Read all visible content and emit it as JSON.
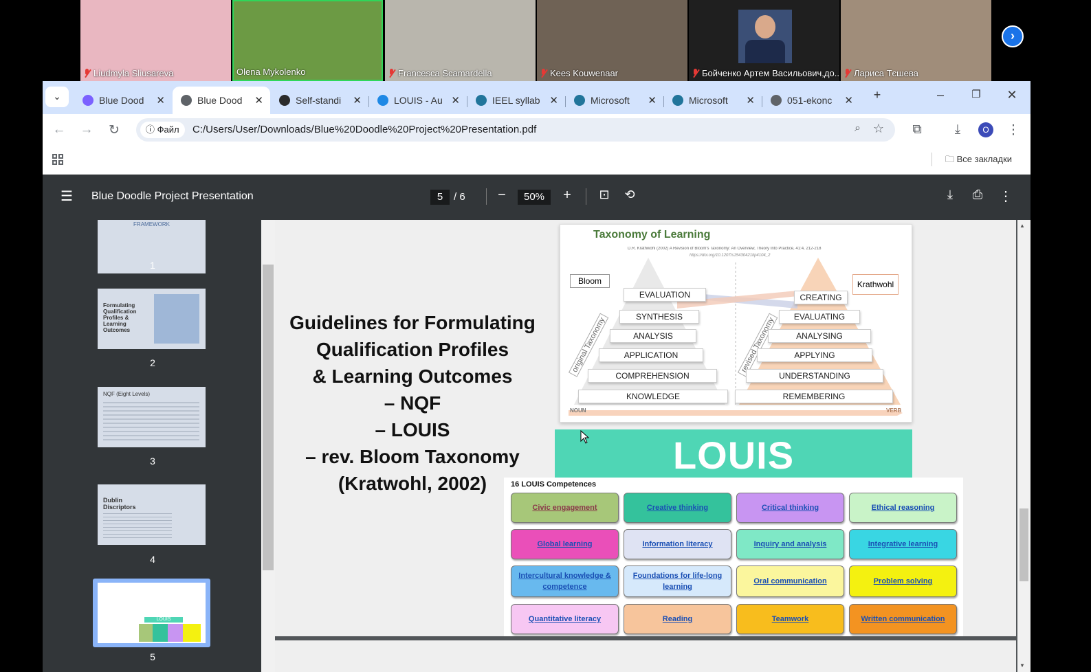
{
  "participants": [
    {
      "name": "Liudmyla Sliusareva",
      "muted": true,
      "bg": "#e9b7c1"
    },
    {
      "name": "Olena Mykolenko",
      "muted": false,
      "bg": "#6c9a44"
    },
    {
      "name": "Francesca Scamardella",
      "muted": true,
      "bg": "#b9b6ad"
    },
    {
      "name": "Kees Kouwenaar",
      "muted": true,
      "bg": "#6f6255"
    },
    {
      "name": "Бойченко Артем Васильович,до...",
      "muted": true,
      "bg": "#1f1f1f"
    },
    {
      "name": "Лариса Тєшева",
      "muted": true,
      "bg": "#a08d7a"
    }
  ],
  "browser": {
    "tabs": [
      {
        "title": "Blue Dood",
        "active": false,
        "color": "#7b61ff"
      },
      {
        "title": "Blue Dood",
        "active": true,
        "color": "#5f6368"
      },
      {
        "title": "Self-standi",
        "active": false,
        "color": "#2b2b2b"
      },
      {
        "title": "LOUIS - Au",
        "active": false,
        "color": "#1e88e5"
      },
      {
        "title": "IEEL syllab",
        "active": false,
        "color": "#21759b"
      },
      {
        "title": "Microsoft",
        "active": false,
        "color": "#21759b"
      },
      {
        "title": "Microsoft",
        "active": false,
        "color": "#21759b"
      },
      {
        "title": "051-ekonc",
        "active": false,
        "color": "#5f6368"
      }
    ],
    "file_chip": "Файл",
    "url": "C:/Users/User/Downloads/Blue%20Doodle%20Project%20Presentation.pdf",
    "profile_initial": "O",
    "bookmarks_label": "Все закладки"
  },
  "pdf": {
    "title": "Blue Doodle Project Presentation",
    "current_page": "5",
    "total_pages": "/ 6",
    "zoom": "50%",
    "thumbnails": [
      {
        "num": "1",
        "text": "FRAMEWORK"
      },
      {
        "num": "2",
        "text": "Formulating Qualification Profiles & Learning Outcomes"
      },
      {
        "num": "3",
        "text": "NQF (Eight Levels)"
      },
      {
        "num": "4",
        "text": "Dublin Discriptors"
      },
      {
        "num": "5",
        "text": "LOUIS"
      }
    ]
  },
  "slide": {
    "heading_lines": [
      "Guidelines for Formulating",
      "Qualification Profiles",
      "& Learning Outcomes",
      "– NQF",
      "– LOUIS",
      "– rev. Bloom Taxonomy",
      "(Kratwohl, 2002)"
    ],
    "taxonomy": {
      "title": "Taxonomy of Learning",
      "citation": "D.R. Krathwohl (2002) A Revision of Bloom's Taxonomy: An Overview, Theory Into Practice, 41:4, 212-218",
      "doi": "https://doi.org/10.1207/s15430421tip4104_2",
      "bloom_label": "Bloom",
      "krathwohl_label": "Krathwohl",
      "original_label": "original Taxonomy",
      "revised_label": "revised Taxonomy",
      "bloom_levels": [
        "EVALUATION",
        "SYNTHESIS",
        "ANALYSIS",
        "APPLICATION",
        "COMPREHENSION",
        "KNOWLEDGE"
      ],
      "revised_levels": [
        "CREATING",
        "EVALUATING",
        "ANALYSING",
        "APPLYING",
        "UNDERSTANDING",
        "REMEMBERING"
      ],
      "noun_label": "NOUN",
      "verb_label": "VERB"
    },
    "louis_banner": "LOUIS",
    "competences_header": "16 LOUIS Competences",
    "competences": [
      {
        "label": "Civic engagement",
        "color": "#a7c779",
        "text_color": "#8a3a4a"
      },
      {
        "label": "Creative thinking",
        "color": "#34c29c",
        "text_color": "#1a4fb4"
      },
      {
        "label": "Critical thinking",
        "color": "#c895f2",
        "text_color": "#1a4fb4"
      },
      {
        "label": "Ethical reasoning",
        "color": "#c9f3c8",
        "text_color": "#1a4fb4"
      },
      {
        "label": "Global learning",
        "color": "#ea4fb9",
        "text_color": "#1a4fb4"
      },
      {
        "label": "Information literacy",
        "color": "#dfe3f3",
        "text_color": "#1a4fb4"
      },
      {
        "label": "Inquiry and analysis",
        "color": "#7fe8c6",
        "text_color": "#1a4fb4"
      },
      {
        "label": "Integrative learning",
        "color": "#39d6e3",
        "text_color": "#1a4fb4"
      },
      {
        "label": "Intercultural knowledge & competence",
        "color": "#68b9ee",
        "text_color": "#1a4fb4"
      },
      {
        "label": "Foundations for life-long learning",
        "color": "#d6e9fb",
        "text_color": "#1a4fb4"
      },
      {
        "label": "Oral communication",
        "color": "#fbf69d",
        "text_color": "#1a4fb4"
      },
      {
        "label": "Problem solving",
        "color": "#f4f110",
        "text_color": "#1a4fb4"
      },
      {
        "label": "Quantitative literacy",
        "color": "#f7c7f3",
        "text_color": "#1a4fb4"
      },
      {
        "label": "Reading",
        "color": "#f7c59c",
        "text_color": "#1a4fb4"
      },
      {
        "label": "Teamwork",
        "color": "#f8bd1d",
        "text_color": "#1a4fb4"
      },
      {
        "label": "Written communication",
        "color": "#f39321",
        "text_color": "#1a4fb4"
      }
    ]
  }
}
